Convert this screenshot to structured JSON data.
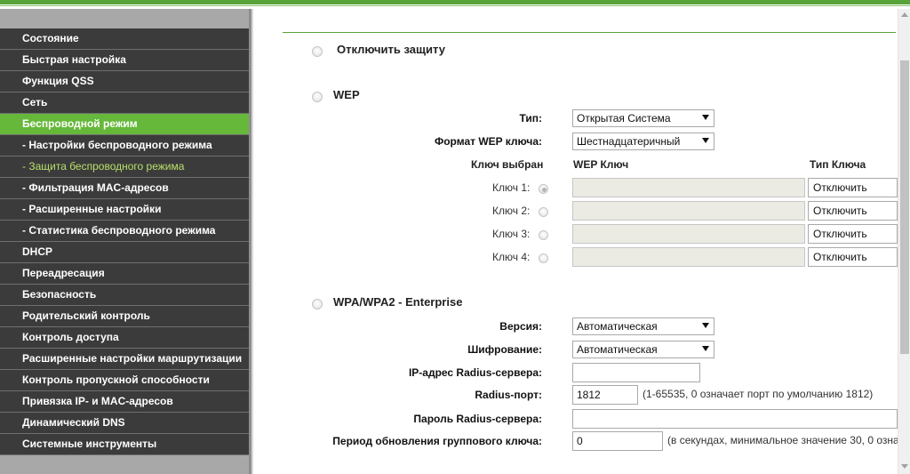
{
  "colors": {
    "accent": "#66b83a",
    "menu_bg": "#3b3b3b",
    "sub_active": "#b8e06a"
  },
  "sidebar": {
    "items": [
      {
        "label": "Состояние"
      },
      {
        "label": "Быстрая настройка"
      },
      {
        "label": "Функция QSS"
      },
      {
        "label": "Сеть"
      },
      {
        "label": "Беспроводной режим"
      },
      {
        "label": "- Настройки беспроводного режима"
      },
      {
        "label": "- Защита беспроводного режима"
      },
      {
        "label": "- Фильтрация MAC-адресов"
      },
      {
        "label": "- Расширенные настройки"
      },
      {
        "label": "- Статистика беспроводного режима"
      },
      {
        "label": "DHCP"
      },
      {
        "label": "Переадресация"
      },
      {
        "label": "Безопасность"
      },
      {
        "label": "Родительский контроль"
      },
      {
        "label": "Контроль доступа"
      },
      {
        "label": "Расширенные настройки маршрутизации"
      },
      {
        "label": "Контроль пропускной способности"
      },
      {
        "label": "Привязка IP- и MAC-адресов"
      },
      {
        "label": "Динамический DNS"
      },
      {
        "label": "Системные инструменты"
      }
    ]
  },
  "disable": {
    "label": "Отключить защиту"
  },
  "wep": {
    "title": "WEP",
    "type_label": "Тип:",
    "type_value": "Открытая Система",
    "format_label": "Формат WEP ключа:",
    "format_value": "Шестнадцатеричный",
    "col_selected": "Ключ выбран",
    "col_key": "WEP Ключ",
    "col_type": "Тип Ключа",
    "keys": [
      {
        "label": "Ключ 1:",
        "value": "",
        "type": "Отключить"
      },
      {
        "label": "Ключ 2:",
        "value": "",
        "type": "Отключить"
      },
      {
        "label": "Ключ 3:",
        "value": "",
        "type": "Отключить"
      },
      {
        "label": "Ключ 4:",
        "value": "",
        "type": "Отключить"
      }
    ]
  },
  "wpa": {
    "title": "WPA/WPA2 - Enterprise",
    "version_label": "Версия:",
    "version_value": "Автоматическая",
    "encryption_label": "Шифрование:",
    "encryption_value": "Автоматическая",
    "radius_ip_label": "IP-адрес Radius-сервера:",
    "radius_ip_value": "",
    "radius_port_label": "Radius-порт:",
    "radius_port_value": "1812",
    "radius_port_hint": "(1-65535, 0 означает порт по умолчанию 1812)",
    "radius_pass_label": "Пароль Radius-сервера:",
    "radius_pass_value": "",
    "group_key_label": "Период обновления группового ключа:",
    "group_key_value": "0",
    "group_key_hint": "(в секундах, минимальное значение 30, 0 озна"
  }
}
